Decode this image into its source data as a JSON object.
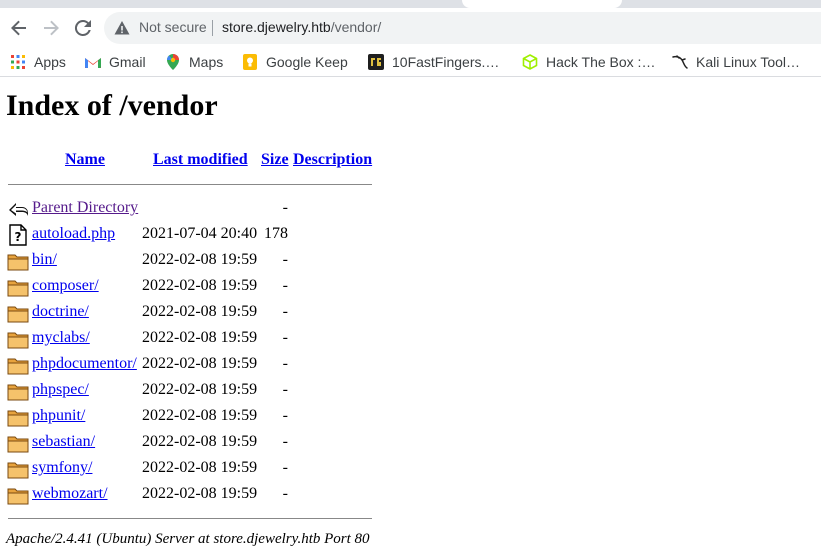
{
  "browser": {
    "not_secure": "Not secure",
    "url_host": "store.djewelry.htb",
    "url_path": "/vendor/"
  },
  "bookmarks": [
    {
      "label": "Apps",
      "icon": "apps-grid-icon"
    },
    {
      "label": "Gmail",
      "icon": "gmail-icon"
    },
    {
      "label": "Maps",
      "icon": "maps-pin-icon"
    },
    {
      "label": "Google Keep",
      "icon": "keep-icon"
    },
    {
      "label": "10FastFingers.…",
      "icon": "tenfastfingers-icon"
    },
    {
      "label": "Hack The Box :…",
      "icon": "htb-cube-icon"
    },
    {
      "label": "Kali Linux Tool…",
      "icon": "kali-dragon-icon"
    }
  ],
  "page": {
    "title": "Index of /vendor",
    "headers": {
      "name": "Name",
      "modified": "Last modified",
      "size": "Size",
      "description": "Description"
    },
    "rows": [
      {
        "name": "Parent Directory",
        "modified": "",
        "size": "-",
        "icon": "back-arrow-icon"
      },
      {
        "name": "autoload.php",
        "modified": "2021-07-04 20:40",
        "size": "178",
        "icon": "unknown-file-icon"
      },
      {
        "name": "bin/",
        "modified": "2022-02-08 19:59",
        "size": "-",
        "icon": "folder-icon"
      },
      {
        "name": "composer/",
        "modified": "2022-02-08 19:59",
        "size": "-",
        "icon": "folder-icon"
      },
      {
        "name": "doctrine/",
        "modified": "2022-02-08 19:59",
        "size": "-",
        "icon": "folder-icon"
      },
      {
        "name": "myclabs/",
        "modified": "2022-02-08 19:59",
        "size": "-",
        "icon": "folder-icon"
      },
      {
        "name": "phpdocumentor/",
        "modified": "2022-02-08 19:59",
        "size": "-",
        "icon": "folder-icon"
      },
      {
        "name": "phpspec/",
        "modified": "2022-02-08 19:59",
        "size": "-",
        "icon": "folder-icon"
      },
      {
        "name": "phpunit/",
        "modified": "2022-02-08 19:59",
        "size": "-",
        "icon": "folder-icon"
      },
      {
        "name": "sebastian/",
        "modified": "2022-02-08 19:59",
        "size": "-",
        "icon": "folder-icon"
      },
      {
        "name": "symfony/",
        "modified": "2022-02-08 19:59",
        "size": "-",
        "icon": "folder-icon"
      },
      {
        "name": "webmozart/",
        "modified": "2022-02-08 19:59",
        "size": "-",
        "icon": "folder-icon"
      }
    ],
    "footer": "Apache/2.4.41 (Ubuntu) Server at store.djewelry.htb Port 80"
  }
}
